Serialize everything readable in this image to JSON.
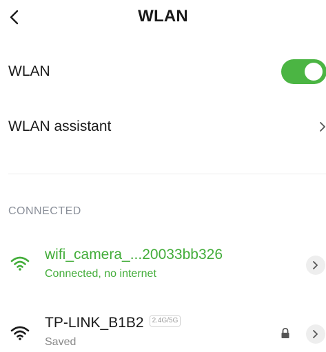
{
  "header": {
    "title": "WLAN",
    "back_icon": "chevron-left-icon"
  },
  "wlan_toggle": {
    "label": "WLAN",
    "enabled": true,
    "accent_color": "#4bb543"
  },
  "wlan_assistant": {
    "label": "WLAN assistant",
    "icon": "chevron-right-icon"
  },
  "sections": {
    "connected_header": "CONNECTED"
  },
  "networks": [
    {
      "name": "wifi_camera_...20033bb326",
      "status": "Connected, no internet",
      "color": "#43ad3a",
      "icon": "wifi-icon",
      "secured": false
    },
    {
      "name": "TP-LINK_B1B2",
      "band": "2.4G/5G",
      "status": "Saved",
      "color": "#1a1a1a",
      "icon": "wifi-icon",
      "secured": true,
      "lock_icon": "lock-icon"
    }
  ]
}
